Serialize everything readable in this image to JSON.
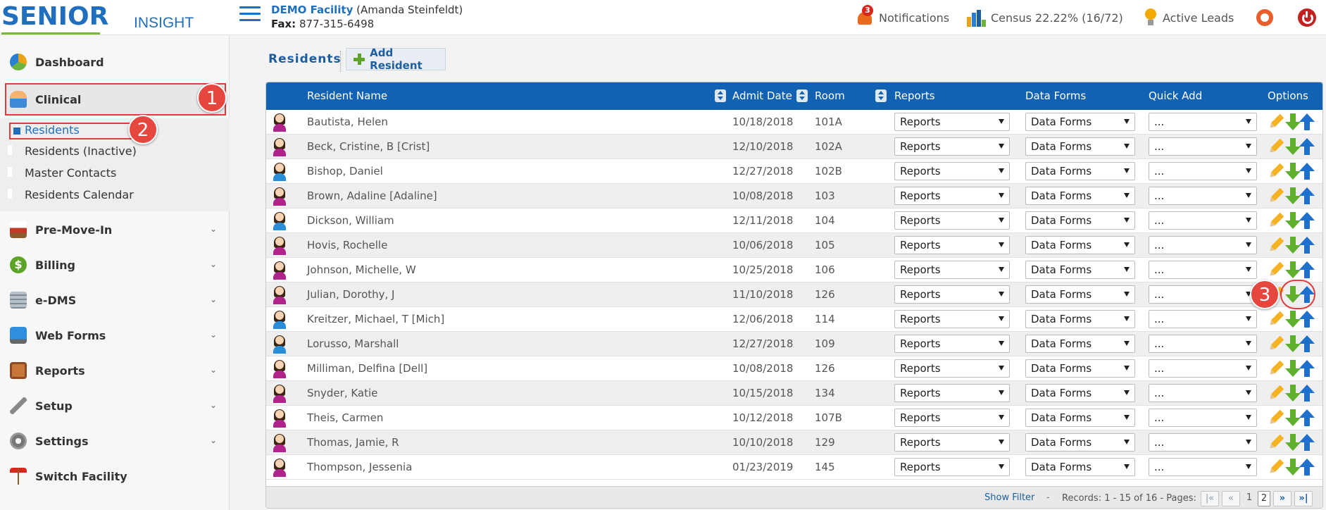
{
  "brand": {
    "word1": "SENIOR",
    "word2": "INSIGHT"
  },
  "facility": {
    "name": "DEMO Facility",
    "user": "(Amanda Steinfeldt)",
    "fax_label": "Fax:",
    "fax": "877-315-6498"
  },
  "header": {
    "notifications_label": "Notifications",
    "notifications_count": "3",
    "census_label": "Census 22.22% (16/72)",
    "leads_label": "Active Leads"
  },
  "sidebar": {
    "items": [
      {
        "label": "Dashboard",
        "icon": "dashboard-icon"
      },
      {
        "label": "Clinical",
        "icon": "clinical-icon"
      },
      {
        "label": "Pre-Move-In",
        "icon": "bed-icon"
      },
      {
        "label": "Billing",
        "icon": "dollar-icon"
      },
      {
        "label": "e-DMS",
        "icon": "documents-icon"
      },
      {
        "label": "Web Forms",
        "icon": "monitor-icon"
      },
      {
        "label": "Reports",
        "icon": "clipboard-icon"
      },
      {
        "label": "Setup",
        "icon": "wrench-icon"
      },
      {
        "label": "Settings",
        "icon": "gear-icon"
      },
      {
        "label": "Switch Facility",
        "icon": "signpost-icon"
      }
    ],
    "clinical_sub": [
      "Residents",
      "Residents (Inactive)",
      "Master Contacts",
      "Residents Calendar"
    ]
  },
  "callouts": [
    "1",
    "2",
    "3"
  ],
  "main": {
    "title": "Residents",
    "add_button": "Add Resident",
    "columns": {
      "name": "Resident Name",
      "admit": "Admit Date",
      "room": "Room",
      "reports": "Reports",
      "forms": "Data Forms",
      "quick": "Quick Add",
      "options": "Options"
    },
    "select_defaults": {
      "reports": "Reports",
      "forms": "Data Forms",
      "quick": "..."
    },
    "rows": [
      {
        "name": "Bautista, Helen",
        "admit": "10/18/2018",
        "room": "101A",
        "gender": "f"
      },
      {
        "name": "Beck, Cristine, B [Crist]",
        "admit": "12/10/2018",
        "room": "102A",
        "gender": "f"
      },
      {
        "name": "Bishop, Daniel",
        "admit": "12/27/2018",
        "room": "102B",
        "gender": "m"
      },
      {
        "name": "Brown, Adaline [Adaline]",
        "admit": "10/08/2018",
        "room": "103",
        "gender": "f"
      },
      {
        "name": "Dickson, William",
        "admit": "12/11/2018",
        "room": "104",
        "gender": "m"
      },
      {
        "name": "Hovis, Rochelle",
        "admit": "10/06/2018",
        "room": "105",
        "gender": "f"
      },
      {
        "name": "Johnson, Michelle, W",
        "admit": "10/25/2018",
        "room": "106",
        "gender": "f"
      },
      {
        "name": "Julian, Dorothy, J",
        "admit": "11/10/2018",
        "room": "126",
        "gender": "f"
      },
      {
        "name": "Kreitzer, Michael, T [Mich]",
        "admit": "12/06/2018",
        "room": "114",
        "gender": "m"
      },
      {
        "name": "Lorusso, Marshall",
        "admit": "12/27/2018",
        "room": "109",
        "gender": "m"
      },
      {
        "name": "Milliman, Delfina [Dell]",
        "admit": "10/08/2018",
        "room": "126",
        "gender": "f"
      },
      {
        "name": "Snyder, Katie",
        "admit": "10/15/2018",
        "room": "134",
        "gender": "f"
      },
      {
        "name": "Theis, Carmen",
        "admit": "10/12/2018",
        "room": "107B",
        "gender": "f"
      },
      {
        "name": "Thomas, Jamie, R",
        "admit": "10/10/2018",
        "room": "129",
        "gender": "f"
      },
      {
        "name": "Thompson, Jessenia",
        "admit": "01/23/2019",
        "room": "145",
        "gender": "f"
      }
    ],
    "footer": {
      "show_filter": "Show Filter",
      "sep": "-",
      "records": "Records: 1 - 15 of 16 - Pages:",
      "pages": [
        "1",
        "2"
      ],
      "current_page": "2"
    }
  }
}
